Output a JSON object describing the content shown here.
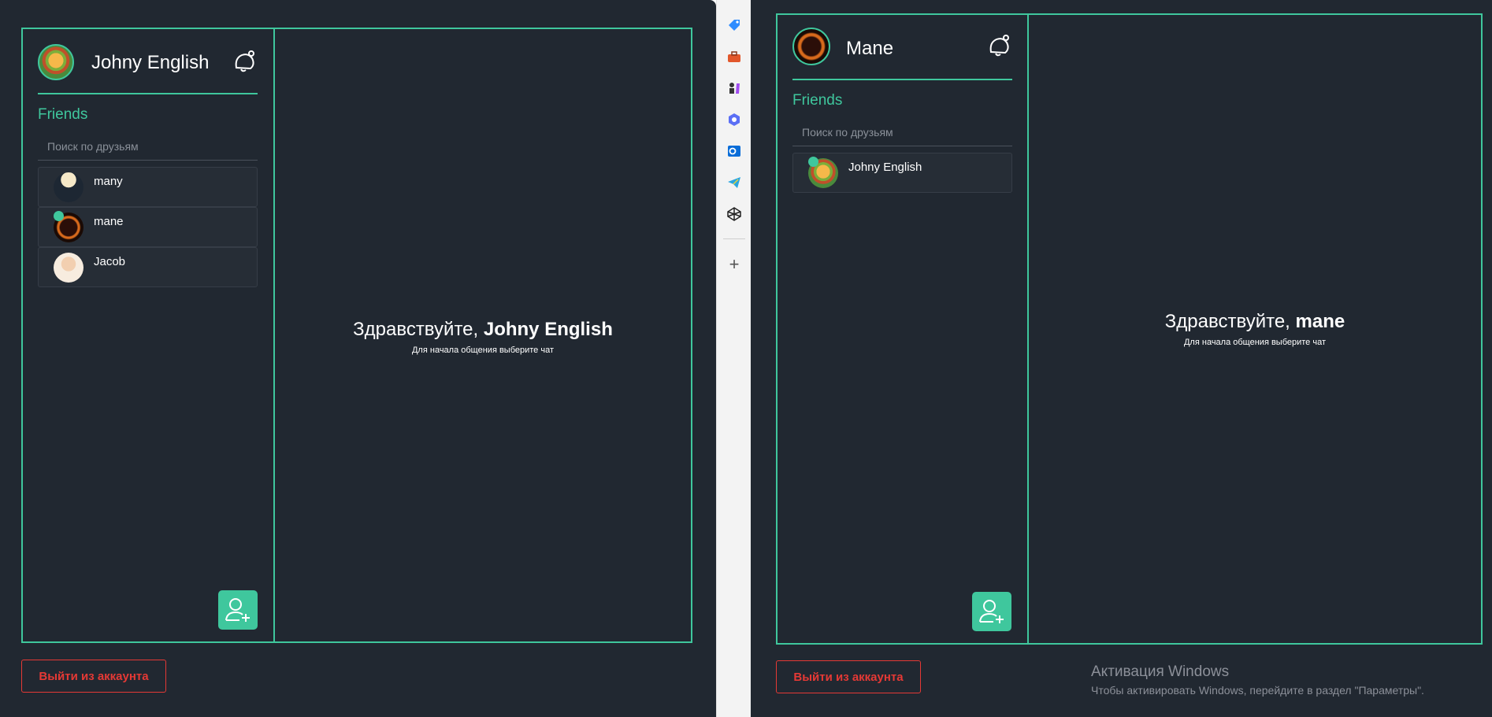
{
  "left": {
    "user_name": "Johny English",
    "friends_title": "Friends",
    "search_placeholder": "Поиск по друзьям",
    "friends": [
      {
        "name": "many",
        "online": false
      },
      {
        "name": "mane",
        "online": true
      },
      {
        "name": "Jacob",
        "online": false
      }
    ],
    "greeting_prefix": "Здравствуйте, ",
    "greeting_name": "Johny English",
    "greeting_sub": "Для начала общения выберите чат",
    "logout_label": "Выйти из аккаунта"
  },
  "right": {
    "user_name": "Mane",
    "friends_title": "Friends",
    "search_placeholder": "Поиск по друзьям",
    "friends": [
      {
        "name": "Johny English",
        "online": true
      }
    ],
    "greeting_prefix": "Здравствуйте, ",
    "greeting_name": "mane",
    "greeting_sub": "Для начала общения выберите чат",
    "logout_label": "Выйти из аккаунта"
  },
  "sidebar_strip": {
    "icons": [
      "tag-icon",
      "toolbox-icon",
      "chess-icon",
      "copilot-icon",
      "outlook-icon",
      "telegram-icon",
      "codepen-icon"
    ],
    "add_label": "+"
  },
  "windows_watermark": {
    "title": "Активация Windows",
    "subtitle": "Чтобы активировать Windows, перейдите в раздел \"Параметры\"."
  },
  "colors": {
    "accent": "#3fc79d",
    "background": "#212831",
    "danger": "#e53935"
  }
}
